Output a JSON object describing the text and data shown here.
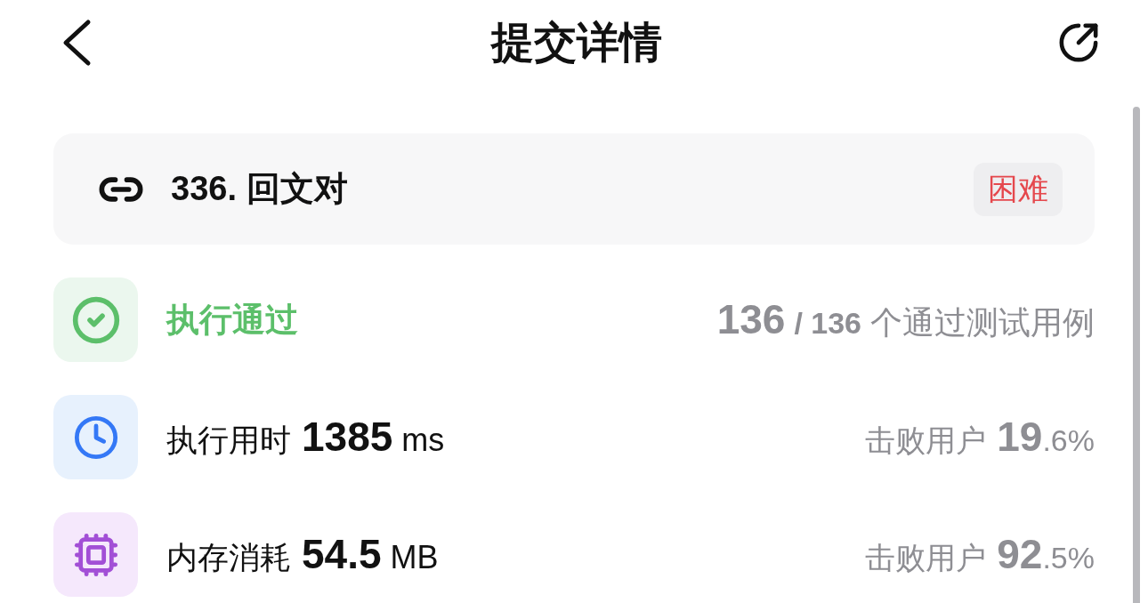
{
  "header": {
    "title": "提交详情"
  },
  "problem": {
    "title": "336. 回文对",
    "difficulty": "困难"
  },
  "result": {
    "status": "执行通过",
    "passed": "136",
    "total": "/ 136",
    "caption": "个通过测试用例"
  },
  "metrics": [
    {
      "kind": "time",
      "label": "执行用时",
      "value": "1385",
      "unit": "ms",
      "beats_label": "击败用户",
      "beats_whole": "19",
      "beats_fraction": ".6%"
    },
    {
      "kind": "memory",
      "label": "内存消耗",
      "value": "54.5",
      "unit": "MB",
      "beats_label": "击败用户",
      "beats_whole": "92",
      "beats_fraction": ".5%"
    }
  ]
}
